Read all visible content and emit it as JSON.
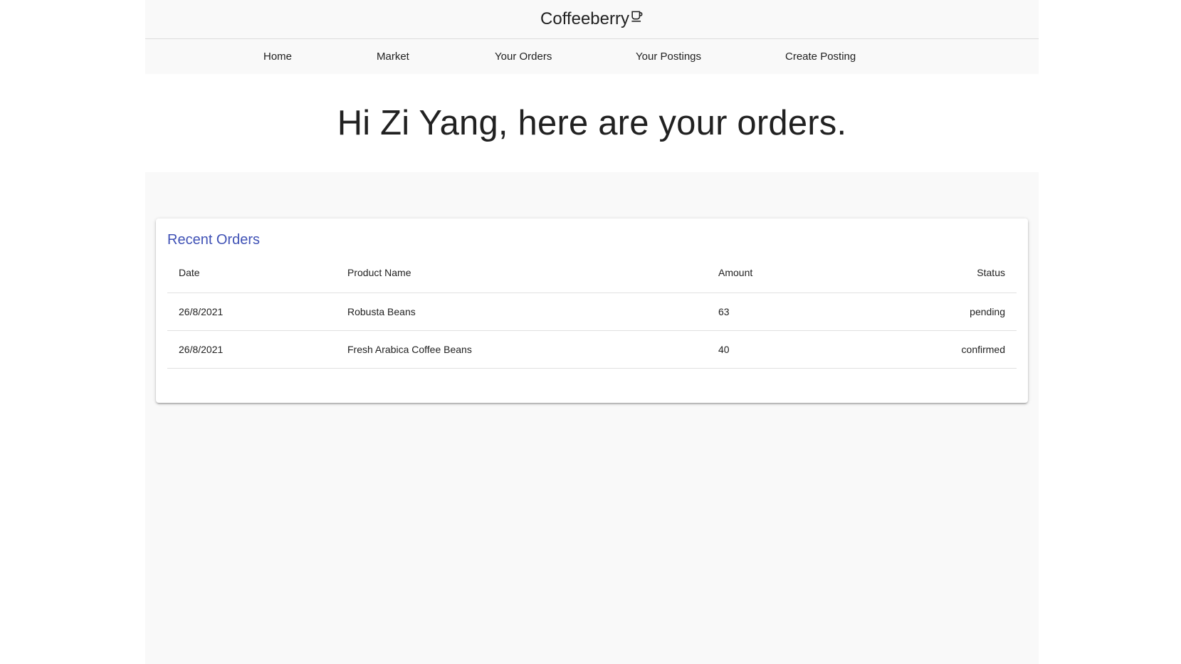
{
  "header": {
    "brand": "Coffeeberry",
    "brand_icon": "coffee-cup-icon"
  },
  "nav": {
    "items": [
      {
        "label": "Home"
      },
      {
        "label": "Market"
      },
      {
        "label": "Your Orders"
      },
      {
        "label": "Your Postings"
      },
      {
        "label": "Create Posting"
      }
    ]
  },
  "greeting": "Hi Zi Yang, here are your orders.",
  "orders": {
    "title": "Recent Orders",
    "title_color": "#3f51b5",
    "columns": [
      "Date",
      "Product Name",
      "Amount",
      "Status"
    ],
    "rows": [
      {
        "date": "26/8/2021",
        "product": "Robusta Beans",
        "amount": "63",
        "status": "pending"
      },
      {
        "date": "26/8/2021",
        "product": "Fresh Arabica Coffee Beans",
        "amount": "40",
        "status": "confirmed"
      }
    ]
  }
}
